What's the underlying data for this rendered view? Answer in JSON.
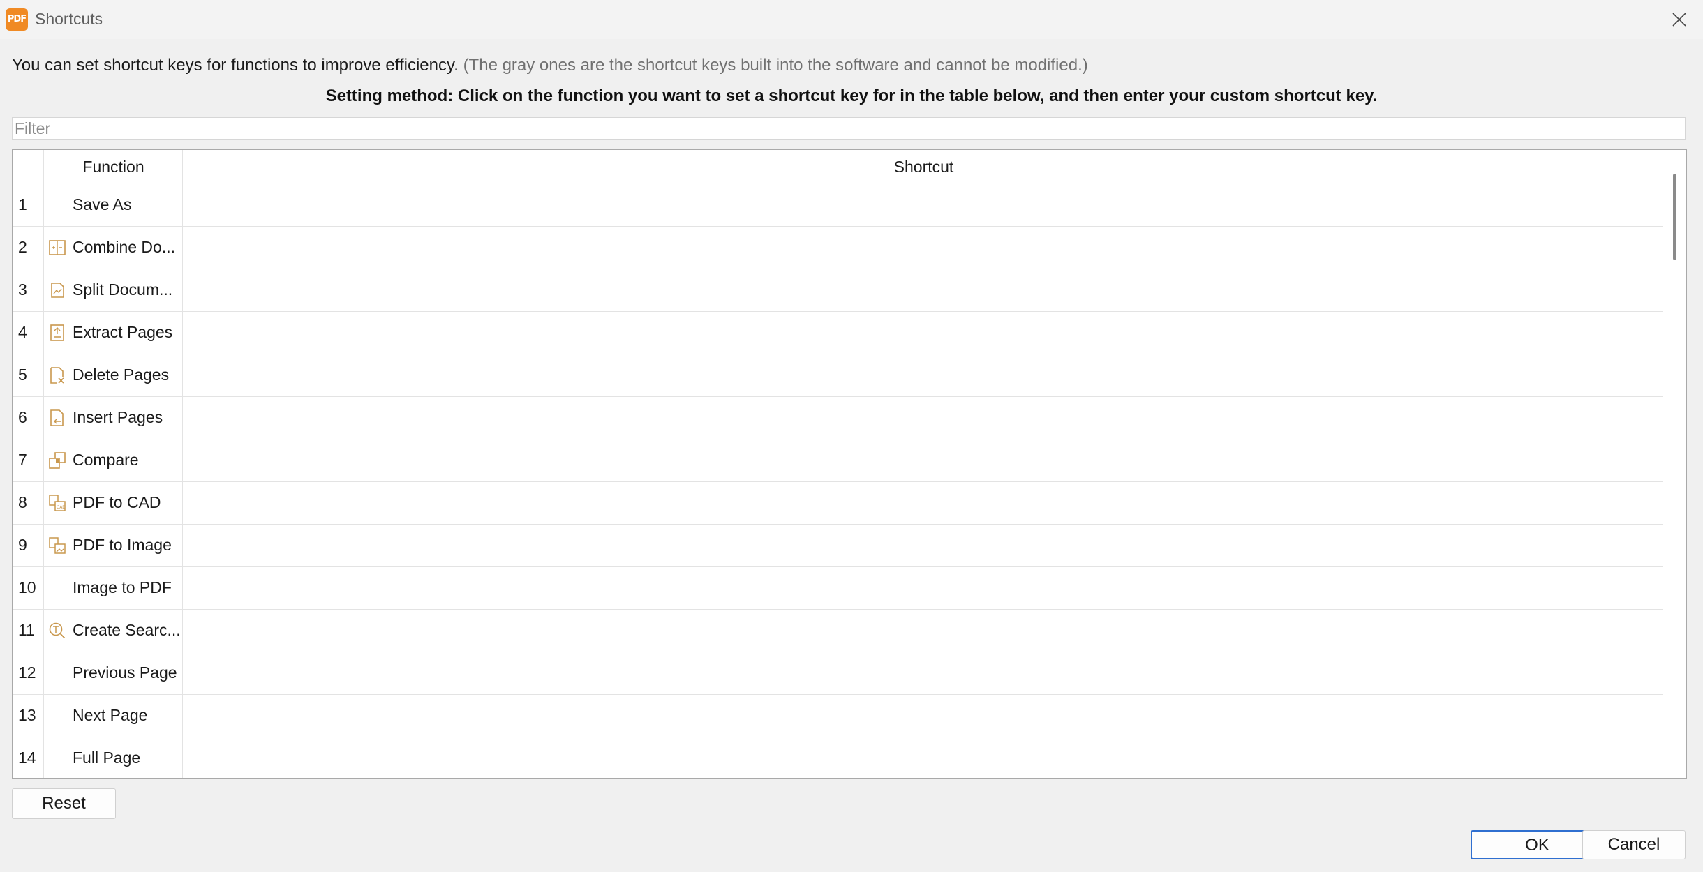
{
  "window": {
    "title": "Shortcuts",
    "logo_text": "PDF",
    "accent_color": "#f08a24"
  },
  "intro": {
    "text": "You can set shortcut keys for functions to improve efficiency.",
    "note": "(The gray ones are the shortcut keys built into the software and cannot be modified.)",
    "method": "Setting method: Click on the function you want to set a shortcut key for in the table below, and then enter your custom shortcut key."
  },
  "filter": {
    "placeholder": "Filter",
    "value": ""
  },
  "table": {
    "headers": {
      "function": "Function",
      "shortcut": "Shortcut"
    },
    "rows": [
      {
        "num": "1",
        "function": "Save As",
        "icon": "none",
        "shortcut": ""
      },
      {
        "num": "2",
        "function": "Combine Do...",
        "icon": "combine-icon",
        "shortcut": ""
      },
      {
        "num": "3",
        "function": "Split Docum...",
        "icon": "split-icon",
        "shortcut": ""
      },
      {
        "num": "4",
        "function": "Extract Pages",
        "icon": "extract-icon",
        "shortcut": ""
      },
      {
        "num": "5",
        "function": "Delete Pages",
        "icon": "delete-pages-icon",
        "shortcut": ""
      },
      {
        "num": "6",
        "function": "Insert Pages",
        "icon": "insert-pages-icon",
        "shortcut": ""
      },
      {
        "num": "7",
        "function": "Compare",
        "icon": "compare-icon",
        "shortcut": ""
      },
      {
        "num": "8",
        "function": "PDF to CAD",
        "icon": "pdf-to-cad-icon",
        "shortcut": ""
      },
      {
        "num": "9",
        "function": "PDF to Image",
        "icon": "pdf-to-image-icon",
        "shortcut": ""
      },
      {
        "num": "10",
        "function": "Image to PDF",
        "icon": "none",
        "shortcut": ""
      },
      {
        "num": "11",
        "function": "Create Searc...",
        "icon": "ocr-search-icon",
        "shortcut": ""
      },
      {
        "num": "12",
        "function": "Previous Page",
        "icon": "none",
        "shortcut": ""
      },
      {
        "num": "13",
        "function": "Next Page",
        "icon": "none",
        "shortcut": ""
      },
      {
        "num": "14",
        "function": "Full Page",
        "icon": "none",
        "shortcut": ""
      }
    ]
  },
  "buttons": {
    "reset": "Reset",
    "ok": "OK",
    "cancel": "Cancel"
  }
}
